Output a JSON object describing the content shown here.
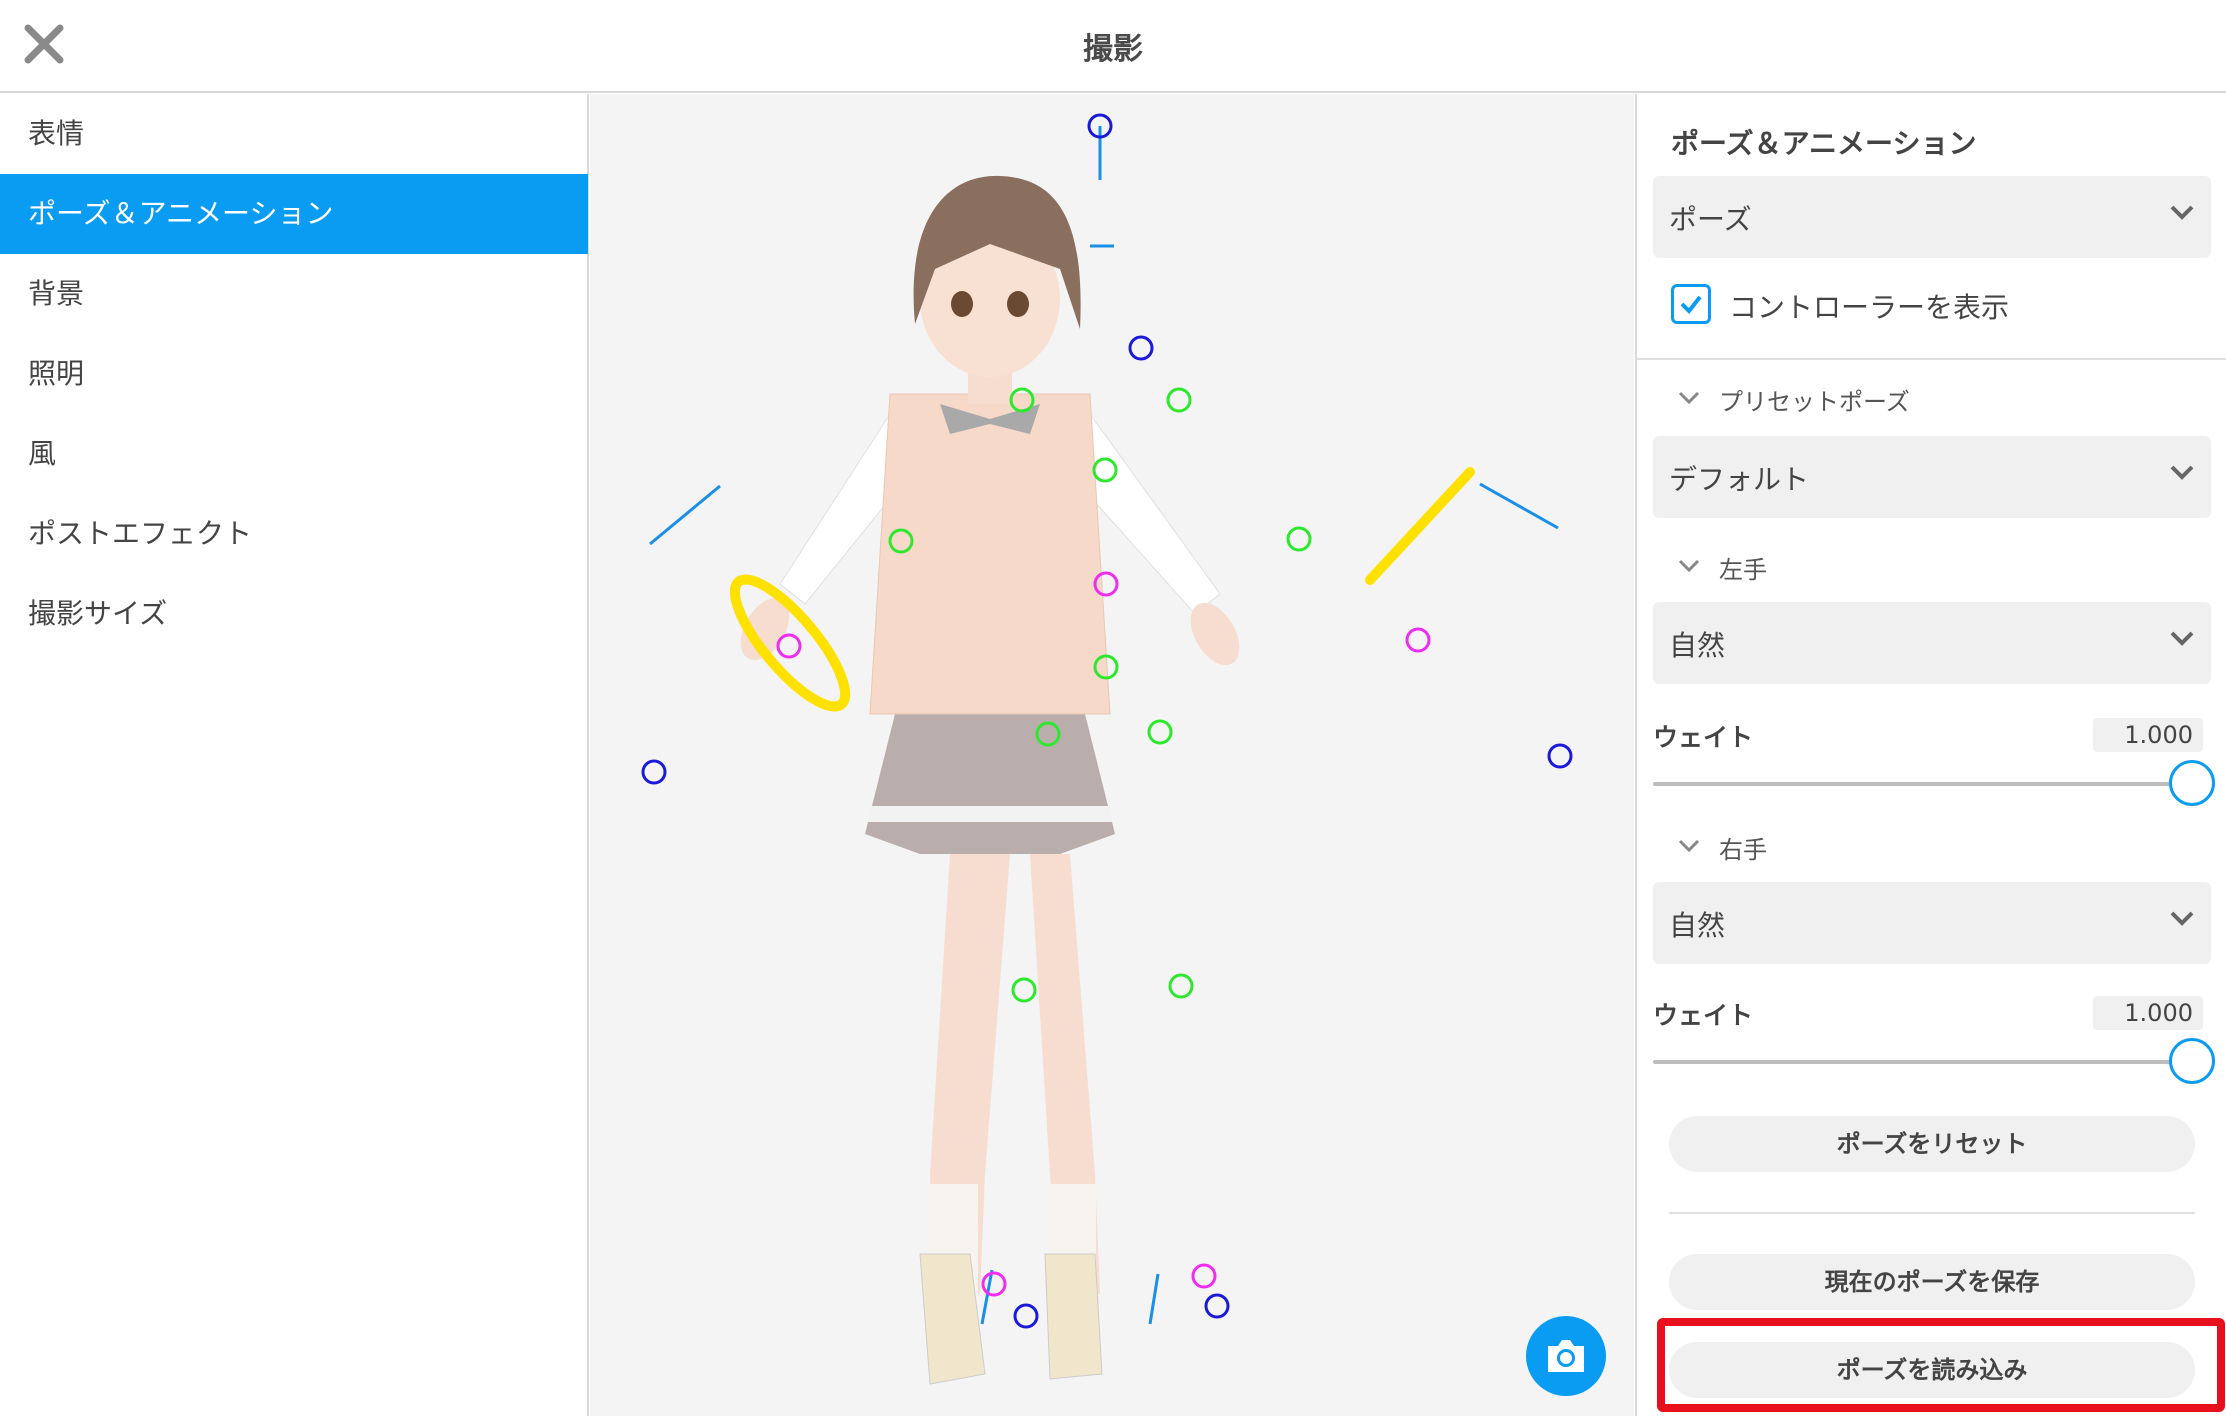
{
  "header": {
    "title": "撮影"
  },
  "sidebar": {
    "items": [
      {
        "label": "表情",
        "active": false
      },
      {
        "label": "ポーズ＆アニメーション",
        "active": true
      },
      {
        "label": "背景",
        "active": false
      },
      {
        "label": "照明",
        "active": false
      },
      {
        "label": "風",
        "active": false
      },
      {
        "label": "ポストエフェクト",
        "active": false
      },
      {
        "label": "撮影サイズ",
        "active": false
      }
    ]
  },
  "panel": {
    "heading": "ポーズ＆アニメーション",
    "mode_select": "ポーズ",
    "show_controller": {
      "label": "コントローラーを表示",
      "checked": true
    },
    "preset_section": {
      "label": "プリセットポーズ",
      "value": "デフォルト"
    },
    "left_hand": {
      "label": "左手",
      "value": "自然",
      "weight_label": "ウェイト",
      "weight": "1.000"
    },
    "right_hand": {
      "label": "右手",
      "value": "自然",
      "weight_label": "ウェイト",
      "weight": "1.000"
    },
    "reset_button": "ポーズをリセット",
    "save_button": "現在のポーズを保存",
    "load_button": "ポーズを読み込み"
  },
  "colors": {
    "accent": "#0a9bf3",
    "highlight": "#e8101c",
    "controller_green": "#2ee82e",
    "controller_magenta": "#f02cf0",
    "controller_blue": "#1a1ad8",
    "ik_yellow": "#ffe100"
  },
  "icons": {
    "close": "close-icon",
    "camera": "camera-icon",
    "chevron": "chevron-down-icon",
    "check": "check-icon"
  }
}
